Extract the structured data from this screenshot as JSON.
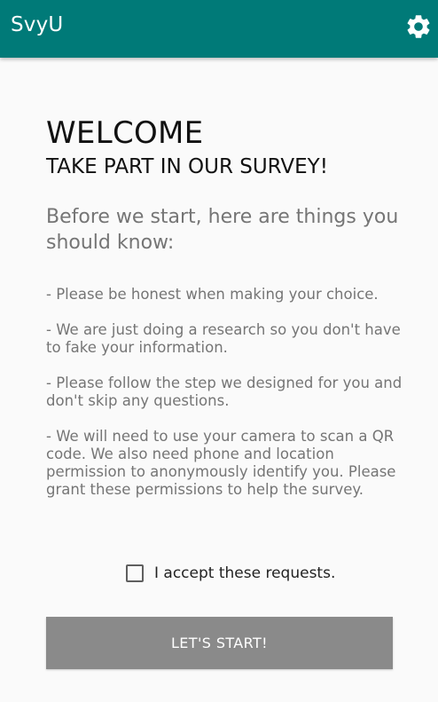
{
  "app_bar": {
    "title": "SvyU",
    "settings_icon": "gear-icon",
    "background_color": "#007a78"
  },
  "content": {
    "welcome": "WELCOME",
    "subtitle": "TAKE PART IN OUR SURVEY!",
    "intro": "Before we start, here are things you should know:",
    "rules": [
      "- Please be honest when making your choice.",
      "- We are just doing a research so you don't have to fake your information.",
      "- Please follow the step we designed for you and don't skip any questions.",
      "- We will need to use your camera to scan a QR code. We also need phone and location permission to anonymously identify you. Please grant these permissions to help the survey."
    ]
  },
  "accept": {
    "label": "I accept these requests.",
    "checked": false
  },
  "start_button": {
    "label": "LET'S START!",
    "enabled": false,
    "background_color": "#8a8a8a"
  }
}
